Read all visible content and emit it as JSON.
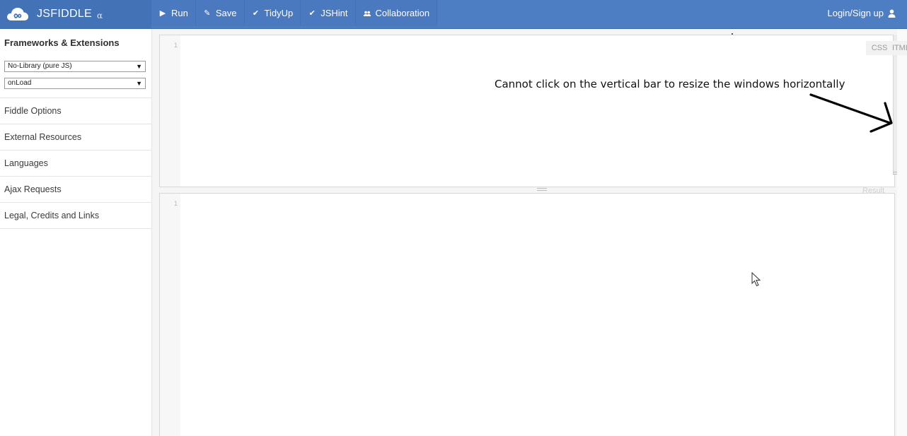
{
  "brand": {
    "name": "JSFIDDLE",
    "tag": "α"
  },
  "toolbar": {
    "run": "Run",
    "save": "Save",
    "tidyup": "TidyUp",
    "jshint": "JSHint",
    "collaboration": "Collaboration",
    "login": "Login/Sign up"
  },
  "sidebar": {
    "heading": "Frameworks & Extensions",
    "framework_select": "No-Library (pure JS)",
    "load_select": "onLoad",
    "items": [
      "Fiddle Options",
      "External Resources",
      "Languages",
      "Ajax Requests",
      "Legal, Credits and Links"
    ]
  },
  "editor": {
    "top_line": "1",
    "bottom_line": "1",
    "tab_css": "CSS",
    "tab_html": "HTML",
    "tab_result": "Result"
  },
  "annotation": {
    "text": "Cannot click on the vertical bar to resize the windows horizontally"
  },
  "colors": {
    "topbar": "#4d7dc2",
    "brand_bg": "#4472b6",
    "accent_text": "#ffffff"
  }
}
